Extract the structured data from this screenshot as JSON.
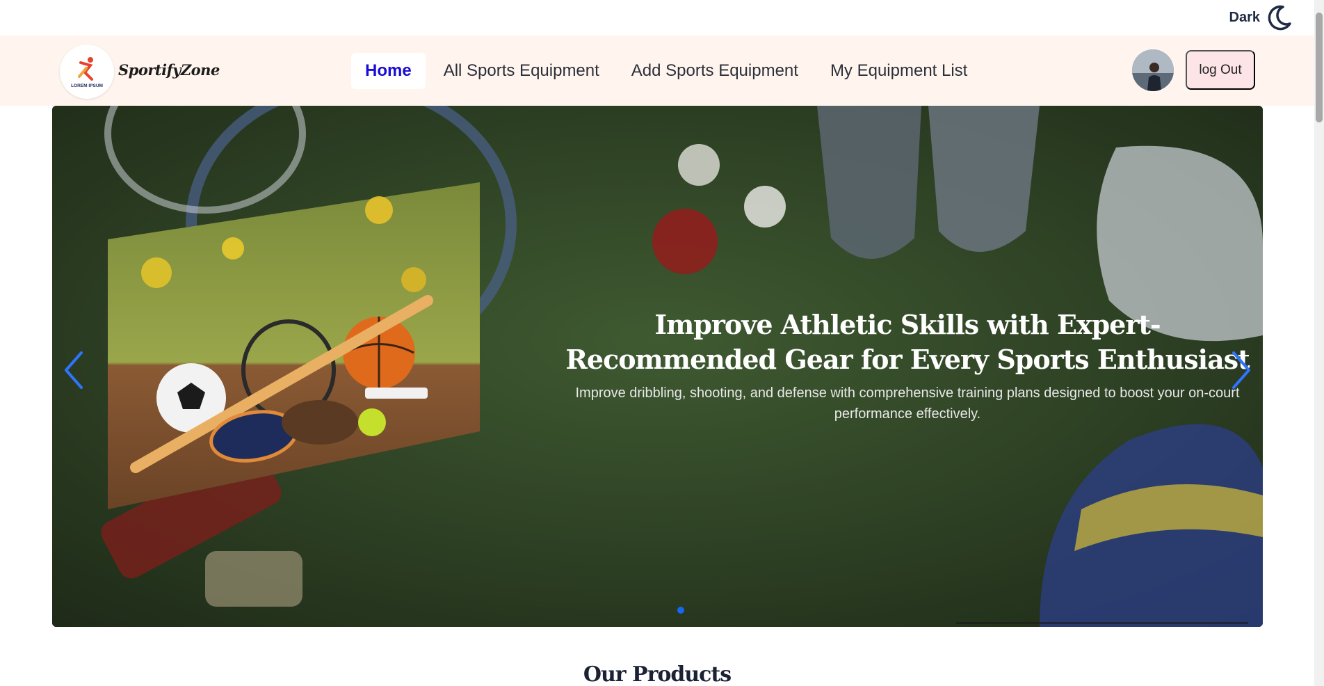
{
  "theme_toggle": {
    "label": "Dark",
    "icon": "moon-icon"
  },
  "navbar": {
    "logo_icon": "lorem-ipsum-logo",
    "logo_text": "LOREM IPSUM",
    "brand": "SportifyZone",
    "links": [
      {
        "label": "Home",
        "active": true
      },
      {
        "label": "All Sports Equipment",
        "active": false
      },
      {
        "label": "Add Sports Equipment",
        "active": false
      },
      {
        "label": "My Equipment List",
        "active": false
      }
    ],
    "logout_label": "log Out"
  },
  "hero": {
    "title": "Improve Athletic Skills with Expert-Recommended Gear for Every Sports Enthusiast",
    "description": "Improve dribbling, shooting, and defense with comprehensive training plans designed to boost your on-court performance effectively.",
    "prev_icon": "chevron-left-icon",
    "next_icon": "chevron-right-icon",
    "slide_count": 1,
    "active_slide": 1
  },
  "sections": {
    "products_title": "Our Products"
  },
  "colors": {
    "navbar_bg": "#fff5ee",
    "active_link": "#1a0dd6",
    "logout_bg": "#fde4e6",
    "dot": "#1668f2"
  }
}
